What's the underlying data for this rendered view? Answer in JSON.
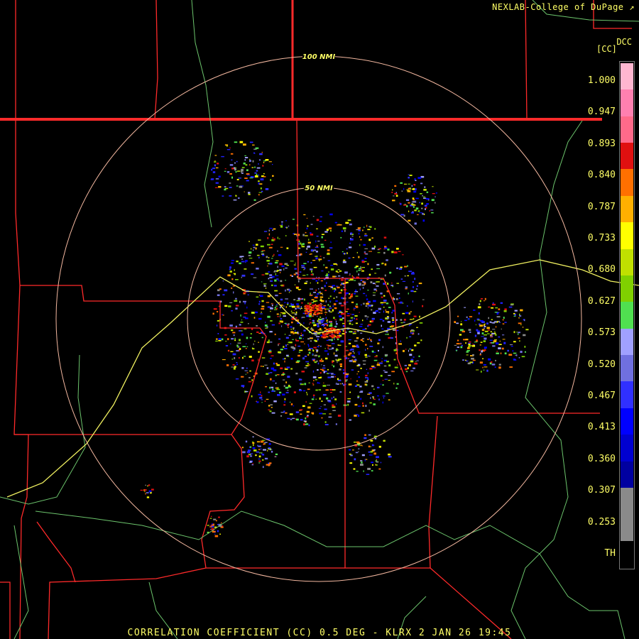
{
  "header": {
    "credit": "NEXLAB-College of DuPage",
    "site_code": "DCC",
    "unit": "[CC]"
  },
  "footer": {
    "product_title": "CORRELATION COEFFICIENT (CC) 0.5 DEG - KLRX 2 JAN 26 19:45"
  },
  "range_rings": [
    {
      "label": "100 NMI"
    },
    {
      "label": "50 NMI"
    }
  ],
  "color_scale": {
    "labels": [
      "1.000",
      "0.947",
      "0.893",
      "0.840",
      "0.787",
      "0.733",
      "0.680",
      "0.627",
      "0.573",
      "0.520",
      "0.467",
      "0.413",
      "0.360",
      "0.307",
      "0.253",
      "TH"
    ],
    "colors": [
      "#ffb6d0",
      "#ff80b0",
      "#ff6a8a",
      "#e01010",
      "#ff7000",
      "#ffb000",
      "#ffff00",
      "#c0e000",
      "#80d000",
      "#50e050",
      "#a0a0ff",
      "#7070e0",
      "#3030ff",
      "#0000ff",
      "#0000d0",
      "#0000a0",
      "#8a8a8a",
      "#8a8a8a",
      "#000000"
    ],
    "title": "CC",
    "accent_text_color": "#ffff66",
    "state_border_color": "#ff2a2a",
    "highway_color": "#7ad07a"
  }
}
